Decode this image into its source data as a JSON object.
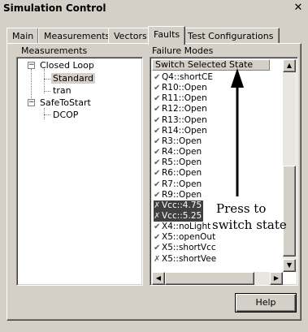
{
  "window": {
    "title": "Simulation Control",
    "close_glyph": "✕"
  },
  "tabs": [
    {
      "label": "Main",
      "active": false
    },
    {
      "label": "Measurements",
      "active": false
    },
    {
      "label": "Vectors",
      "active": false
    },
    {
      "label": "Faults",
      "active": true
    },
    {
      "label": "Test Configurations",
      "active": false
    }
  ],
  "measurements": {
    "label": "Measurements",
    "tree": [
      {
        "label": "Closed Loop",
        "expander": "−"
      },
      {
        "label": "Standard",
        "selected": true
      },
      {
        "label": "tran"
      },
      {
        "label": "SafeToStart",
        "expander": "−"
      },
      {
        "label": "DCOP"
      }
    ]
  },
  "failure_modes": {
    "label": "Failure Modes",
    "header": "Switch Selected State",
    "items": [
      {
        "mark": "✔",
        "label": "Q4::shortCE"
      },
      {
        "mark": "✔",
        "label": "R10::Open"
      },
      {
        "mark": "✔",
        "label": "R11::Open"
      },
      {
        "mark": "✔",
        "label": "R12::Open"
      },
      {
        "mark": "✔",
        "label": "R13::Open"
      },
      {
        "mark": "✔",
        "label": "R14::Open"
      },
      {
        "mark": "✔",
        "label": "R3::Open"
      },
      {
        "mark": "✔",
        "label": "R4::Open"
      },
      {
        "mark": "✔",
        "label": "R5::Open"
      },
      {
        "mark": "✔",
        "label": "R6::Open"
      },
      {
        "mark": "✔",
        "label": "R7::Open"
      },
      {
        "mark": "✔",
        "label": "R9::Open"
      },
      {
        "mark": "✗",
        "label": "Vcc::4.75",
        "failed": true
      },
      {
        "mark": "✗",
        "label": "Vcc::5.25",
        "failed": true
      },
      {
        "mark": "✔",
        "label": "X4::noLight"
      },
      {
        "mark": "✔",
        "label": "X5::openOut"
      },
      {
        "mark": "✔",
        "label": "X5::shortVcc"
      },
      {
        "mark": "✗",
        "label": "X5::shortVee"
      }
    ]
  },
  "annotation": {
    "line1": "Press to",
    "line2": "switch state"
  },
  "help_button": {
    "label": "Help"
  },
  "icons": {
    "check": "check-icon",
    "cross": "cross-icon",
    "up": "▲",
    "down": "▼",
    "left": "◀",
    "right": "▶"
  }
}
